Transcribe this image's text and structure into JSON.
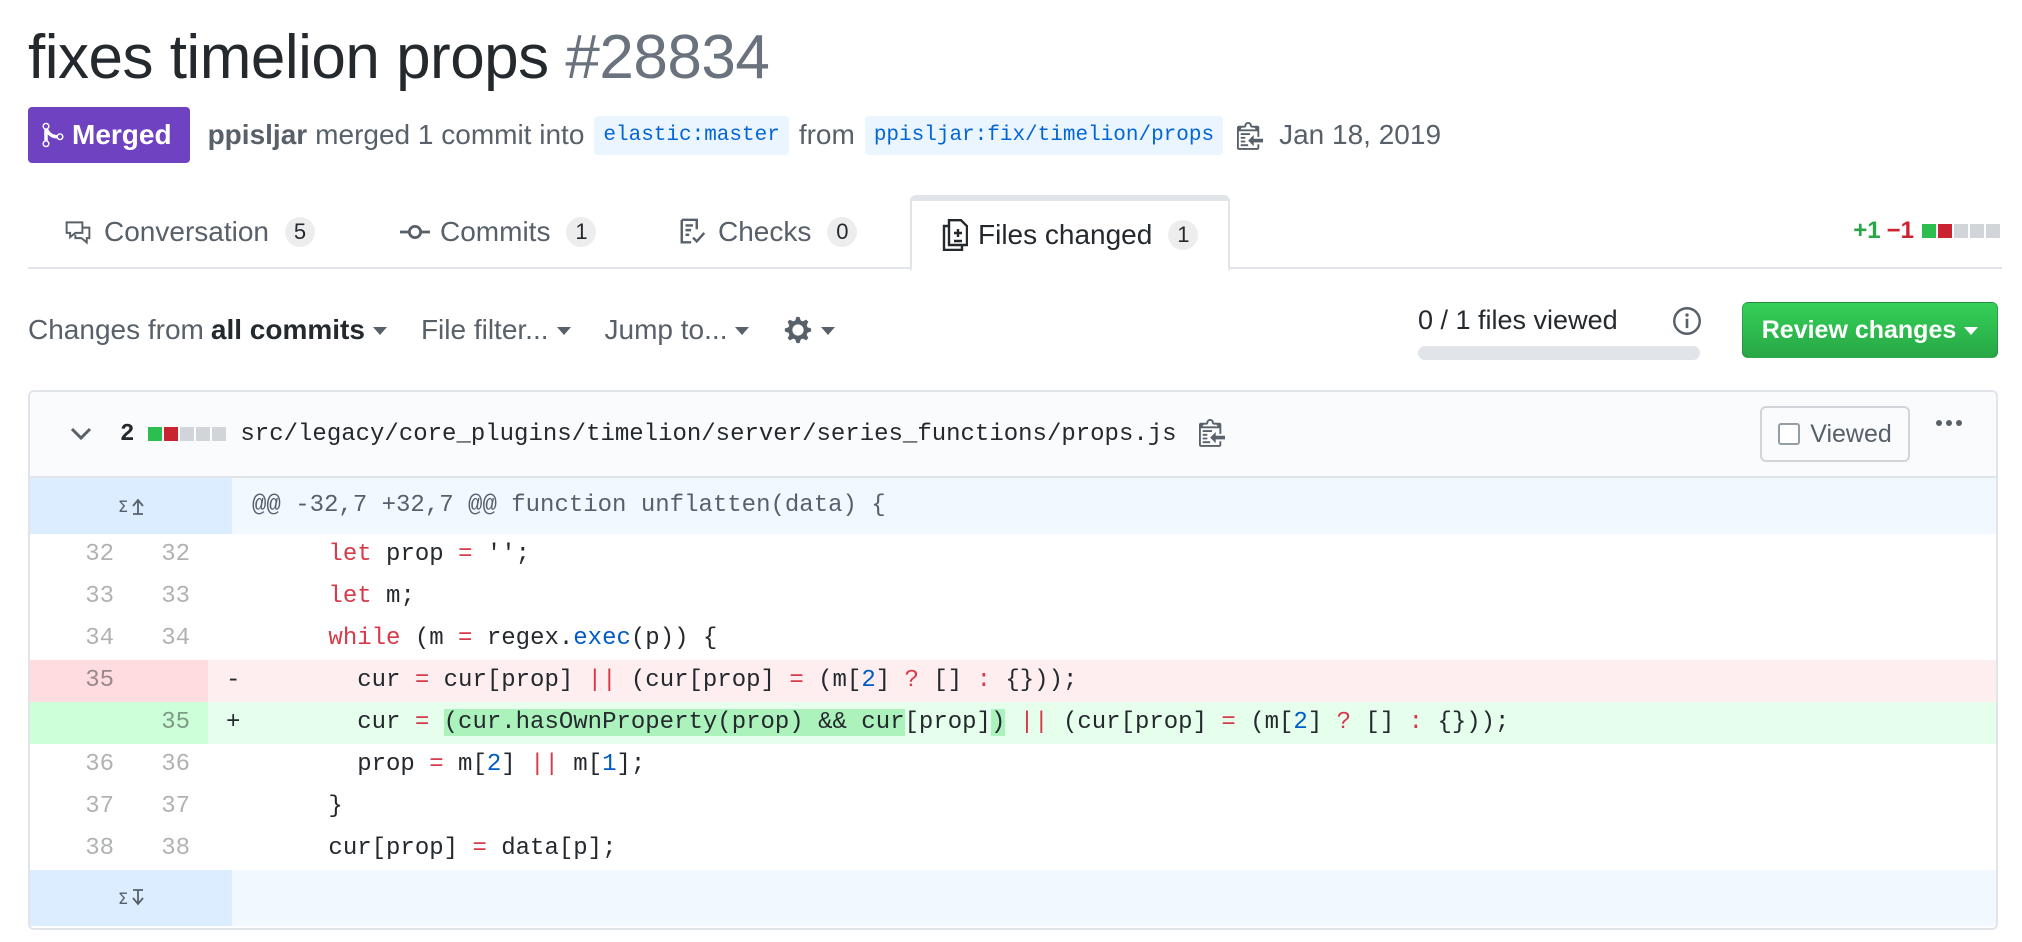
{
  "pr": {
    "title": "fixes timelion props",
    "number": "#28834",
    "state_label": "Merged",
    "author": "ppisljar",
    "action_text": "merged 1 commit into",
    "base_branch": "elastic:master",
    "from_text": "from",
    "head_branch": "ppisljar:fix/timelion/props",
    "date": "Jan 18, 2019"
  },
  "tabs": [
    {
      "label": "Conversation",
      "count": "5",
      "icon": "comment-discussion-icon"
    },
    {
      "label": "Commits",
      "count": "1",
      "icon": "git-commit-icon"
    },
    {
      "label": "Checks",
      "count": "0",
      "icon": "checklist-icon"
    },
    {
      "label": "Files changed",
      "count": "1",
      "icon": "file-diff-icon",
      "active": true
    }
  ],
  "diffstat": {
    "additions": "+1",
    "deletions": "−1"
  },
  "toolbar": {
    "changes_prefix": "Changes from",
    "changes_value": "all commits",
    "file_filter": "File filter...",
    "jump_to": "Jump to...",
    "files_viewed": "0 / 1 files viewed",
    "files_viewed_fraction": 0,
    "review_button": "Review changes"
  },
  "file": {
    "change_count": "2",
    "path": "src/legacy/core_plugins/timelion/server/series_functions/props.js",
    "viewed_label": "Viewed",
    "hunk_header": "@@ -32,7 +32,7 @@ function unflatten(data) {",
    "lines": [
      {
        "old": "32",
        "new": "32",
        "type": "context"
      },
      {
        "old": "33",
        "new": "33",
        "type": "context"
      },
      {
        "old": "34",
        "new": "34",
        "type": "context"
      },
      {
        "old": "35",
        "new": "",
        "type": "deletion",
        "marker": "-"
      },
      {
        "old": "",
        "new": "35",
        "type": "addition",
        "marker": "+"
      },
      {
        "old": "36",
        "new": "36",
        "type": "context"
      },
      {
        "old": "37",
        "new": "37",
        "type": "context"
      },
      {
        "old": "38",
        "new": "38",
        "type": "context"
      }
    ],
    "code": {
      "l0": {
        "a": "      ",
        "kw": "let",
        "b": " prop ",
        "op": "=",
        "c": " '';"
      },
      "l1": {
        "a": "      ",
        "kw": "let",
        "b": " m;"
      },
      "l2": {
        "a": "      ",
        "kw": "while",
        "b": " (m ",
        "op": "=",
        "c": " regex.",
        "fn": "exec",
        "d": "(p)) {"
      },
      "l3": {
        "a": "        cur ",
        "op1": "=",
        "b": " cur[prop] ",
        "op2": "||",
        "c": " (cur[prop] ",
        "op3": "=",
        "d": " (m[",
        "n": "2",
        "e": "] ",
        "op4": "?",
        "f": " [] ",
        "op5": ":",
        "g": " {}));"
      },
      "l4": {
        "a": "        cur ",
        "op1": "=",
        "b": " ",
        "hl": "(cur.hasOwnProperty(prop) && cur",
        "c": "[prop]",
        "hl2": ")",
        "d": " ",
        "op2": "||",
        "e": " (cur[prop] ",
        "op3": "=",
        "f": " (m[",
        "n": "2",
        "g": "] ",
        "op4": "?",
        "h": " [] ",
        "op5": ":",
        "i": " {}));"
      },
      "l5": {
        "a": "        prop ",
        "op1": "=",
        "b": " m[",
        "n1": "2",
        "c": "] ",
        "op2": "||",
        "d": " m[",
        "n2": "1",
        "e": "];"
      },
      "l6": {
        "a": "      }"
      },
      "l7": {
        "a": "      cur[prop] ",
        "op": "=",
        "b": " data[p];"
      }
    }
  },
  "colors": {
    "merged": "#6f42c1",
    "review_button": "#2ea44f",
    "addition_bg": "#e6ffed",
    "deletion_bg": "#ffeef0",
    "hunk_bg": "#f1f8ff"
  }
}
